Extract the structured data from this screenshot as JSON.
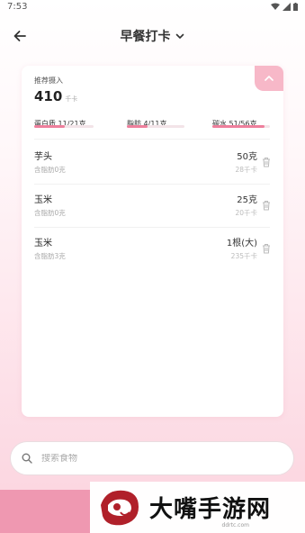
{
  "status": {
    "time": "7:53",
    "icons": [
      "wifi-icon",
      "signal-icon",
      "battery-icon"
    ]
  },
  "header": {
    "title": "早餐打卡"
  },
  "summary": {
    "label": "推荐摄入",
    "value": "410",
    "unit": "千卡",
    "macros": [
      {
        "label": "蛋白质 11/21克",
        "progress": 0.52
      },
      {
        "label": "脂肪 4/11克",
        "progress": 0.36
      },
      {
        "label": "碳水 51/56克",
        "progress": 0.91
      }
    ]
  },
  "foods": [
    {
      "name": "芋头",
      "sub": "含脂肪0克",
      "qty": "50克",
      "kcal": "28千卡"
    },
    {
      "name": "玉米",
      "sub": "含脂肪0克",
      "qty": "25克",
      "kcal": "20千卡"
    },
    {
      "name": "玉米",
      "sub": "含脂肪3克",
      "qty": "1根(大)",
      "kcal": "235千卡"
    }
  ],
  "search": {
    "placeholder": "搜索食物"
  },
  "watermark": {
    "text": "大嘴手游网",
    "sub": "ddrtc.com"
  },
  "colors": {
    "accent": "#ee7f9c",
    "collapse": "#f7b8c8",
    "bottom": "#ef98b1"
  }
}
